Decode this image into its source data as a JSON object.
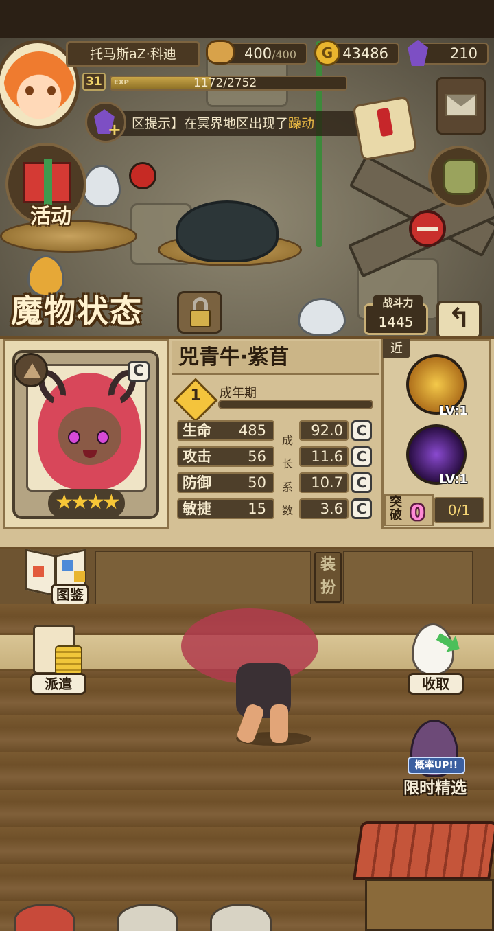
{
  "hud": {
    "player_name": "托马斯aZ·科迪",
    "level": "31",
    "exp_tag": "EXP",
    "exp_text": "1172/2752",
    "exp_fraction": 0.426,
    "stamina": {
      "current": "400",
      "max": "/400",
      "icon": "bread-icon"
    },
    "gold": {
      "value": "43486",
      "icon": "gold-coin-icon"
    },
    "gems": {
      "value": "210",
      "icon": "purple-gem-icon"
    },
    "notice_prefix": "区提示】在冥界地区出现了",
    "notice_highlight": "躁动"
  },
  "side_buttons": {
    "activity_label": "活动"
  },
  "monster_screen": {
    "title": "魔物状态",
    "power_label": "战斗力",
    "power_value": "1445",
    "back_glyph": "↰",
    "name": "兕青牛·紫苜",
    "element_rank": "C",
    "stars": "★★★★",
    "star_count": 4,
    "stage_number": "1",
    "stage_name": "成年期",
    "stats": [
      {
        "label": "生命",
        "value": "485",
        "growth": "92.0",
        "grade": "C"
      },
      {
        "label": "攻击",
        "value": "56",
        "growth": "11.6",
        "grade": "C"
      },
      {
        "label": "防御",
        "value": "50",
        "growth": "10.7",
        "grade": "C"
      },
      {
        "label": "敏捷",
        "value": "15",
        "growth": "3.6",
        "grade": "C"
      }
    ],
    "growth_chars": [
      "成",
      "长",
      "系",
      "数"
    ],
    "range_tag": "近",
    "skills": [
      {
        "lv": "LV:1",
        "icon": "beast-charge-skill-icon",
        "color": "#e3a52a"
      },
      {
        "lv": "LV:1",
        "icon": "shadow-skill-icon",
        "color": "#5a2a88"
      }
    ],
    "break_label": "突破",
    "break_value": "0",
    "break_count": "0/1"
  },
  "lower": {
    "book_label": "图鉴",
    "equip_label": "装扮",
    "dispatch_label": "派遣",
    "collect_label": "收取",
    "rate_up_label": "概率UP!!",
    "limited_label": "限时精选"
  },
  "colors": {
    "panel": "#d4c095",
    "dark_slot": "#4e3f2a",
    "accent_gold": "#f0d36a",
    "break_pink": "#ff8ad6"
  }
}
